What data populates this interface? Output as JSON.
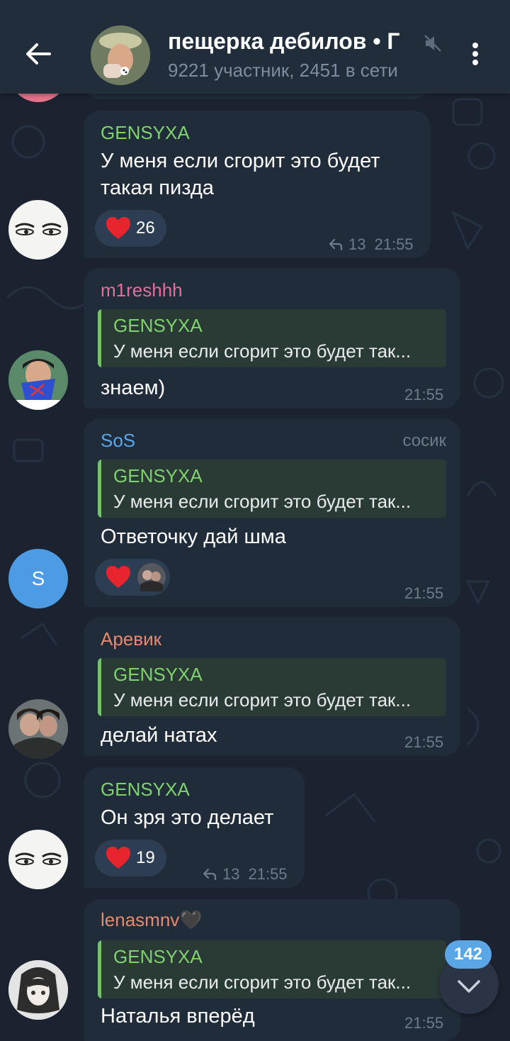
{
  "header": {
    "title": "пещерка дебилов • Г",
    "subtitle": "9221 участник, 2451 в сети"
  },
  "colors": {
    "background": "#1b2331",
    "header": "#212d3b",
    "bubble": "#212c3a",
    "green_name": "#7fd36c",
    "pink_name": "#e36d9b",
    "blue_name": "#5aa6e6",
    "orange_name": "#e58a6e",
    "badge": "#5aa6e6"
  },
  "messages": [
    {
      "sender": "GENSYXA",
      "text_line1": "У меня если сгорит это будет",
      "text_line2": "такая пизда",
      "reaction_count": "26",
      "reply_count": "13",
      "time": "21:55"
    },
    {
      "sender": "m1reshhh",
      "reply_name": "GENSYXA",
      "reply_text": "У меня если сгорит это будет так...",
      "text": "знаем)",
      "time": "21:55"
    },
    {
      "sender": "SoS",
      "admin_title": "сосик",
      "reply_name": "GENSYXA",
      "reply_text": "У меня если сгорит это будет так...",
      "text": "Ответочку дай шма",
      "time": "21:55",
      "avatar_letter": "S"
    },
    {
      "sender": "Аревик",
      "reply_name": "GENSYXA",
      "reply_text": "У меня если сгорит это будет так...",
      "text": "делай натах",
      "time": "21:55"
    },
    {
      "sender": "GENSYXA",
      "text": "Он зря это делает",
      "reaction_count": "19",
      "reply_count": "13",
      "time": "21:55"
    },
    {
      "sender": "lenasmnv🖤",
      "reply_name": "GENSYXA",
      "reply_text": "У меня если сгорит это будет так...",
      "text": "Наталья вперёд",
      "time": "21:55"
    }
  ],
  "scroll": {
    "unread_count": "142"
  }
}
